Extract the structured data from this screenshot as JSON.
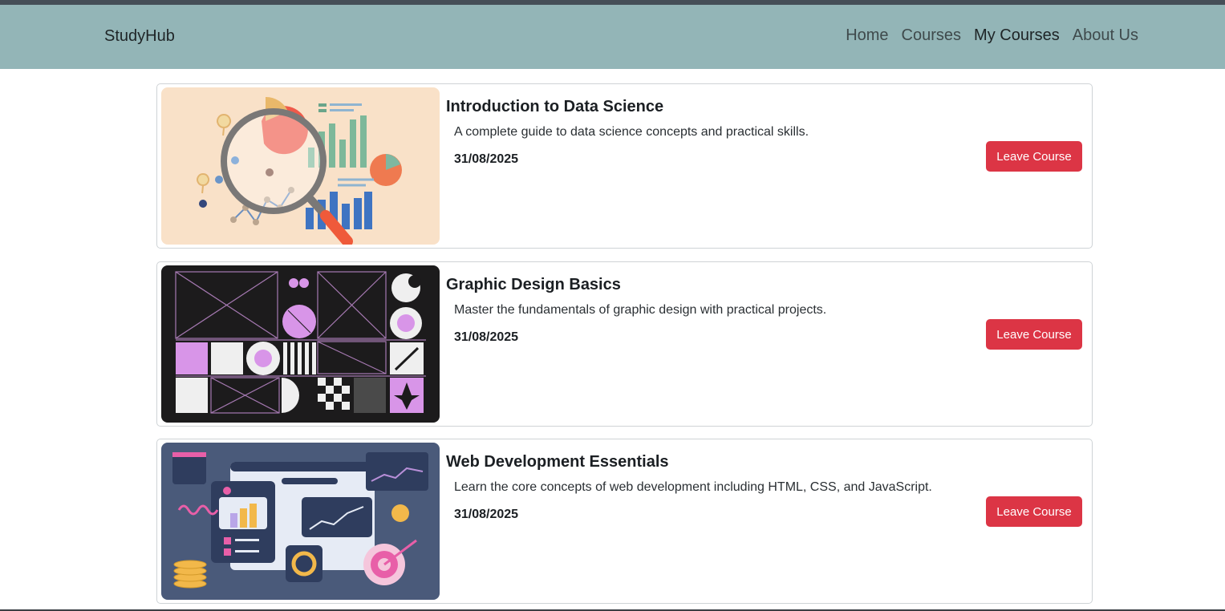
{
  "app": {
    "brand": "StudyHub"
  },
  "nav": {
    "items": [
      "Home",
      "Courses",
      "My Courses",
      "About Us"
    ],
    "active": "My Courses"
  },
  "courses": [
    {
      "title": "Introduction to Data Science",
      "description": "A complete guide to data science concepts and practical skills.",
      "date": "31/08/2025",
      "action": "Leave Course"
    },
    {
      "title": "Graphic Design Basics",
      "description": "Master the fundamentals of graphic design with practical projects.",
      "date": "31/08/2025",
      "action": "Leave Course"
    },
    {
      "title": "Web Development Essentials",
      "description": "Learn the core concepts of web development including HTML, CSS, and JavaScript.",
      "date": "31/08/2025",
      "action": "Leave Course"
    }
  ],
  "colors": {
    "navbar": "#93b5b7",
    "danger": "#dc3545",
    "topstripe": "#454e57"
  }
}
